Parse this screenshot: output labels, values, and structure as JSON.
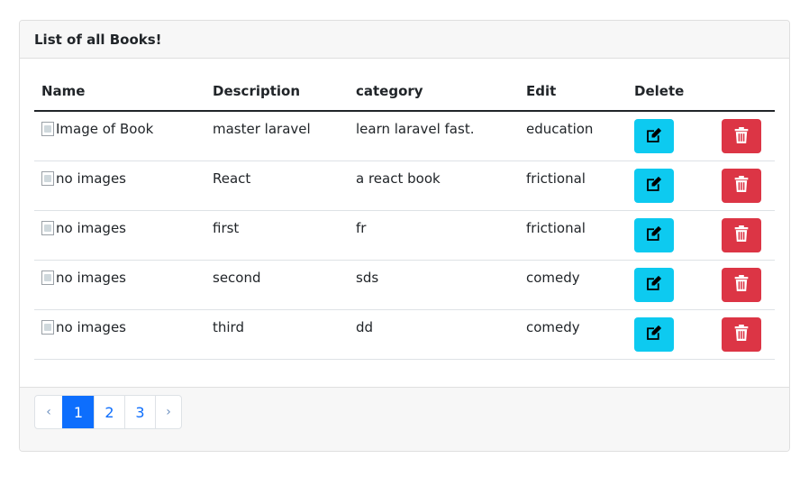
{
  "card": {
    "title": "List of all Books!"
  },
  "table": {
    "headers": {
      "name": "Name",
      "description": "Description",
      "category": "category",
      "edit": "Edit",
      "delete": "Delete"
    },
    "rows": [
      {
        "image_alt": "Image of Book",
        "description": "master laravel",
        "category": "learn laravel fast.",
        "edit_value": "education"
      },
      {
        "image_alt": "no images",
        "description": "React",
        "category": "a react book",
        "edit_value": "frictional"
      },
      {
        "image_alt": "no images",
        "description": "first",
        "category": "fr",
        "edit_value": "frictional"
      },
      {
        "image_alt": "no images",
        "description": "second",
        "category": "sds",
        "edit_value": "comedy"
      },
      {
        "image_alt": "no images",
        "description": "third",
        "category": "dd",
        "edit_value": "comedy"
      }
    ]
  },
  "icons": {
    "edit": "edit-square-icon",
    "delete": "trash-icon",
    "broken_image": "broken-image-icon"
  },
  "colors": {
    "edit_button": "#0dcaf0",
    "delete_button": "#dc3545",
    "active_page": "#0d6efd"
  },
  "pagination": {
    "prev": "‹",
    "pages": [
      "1",
      "2",
      "3"
    ],
    "next": "›",
    "active": "1"
  }
}
